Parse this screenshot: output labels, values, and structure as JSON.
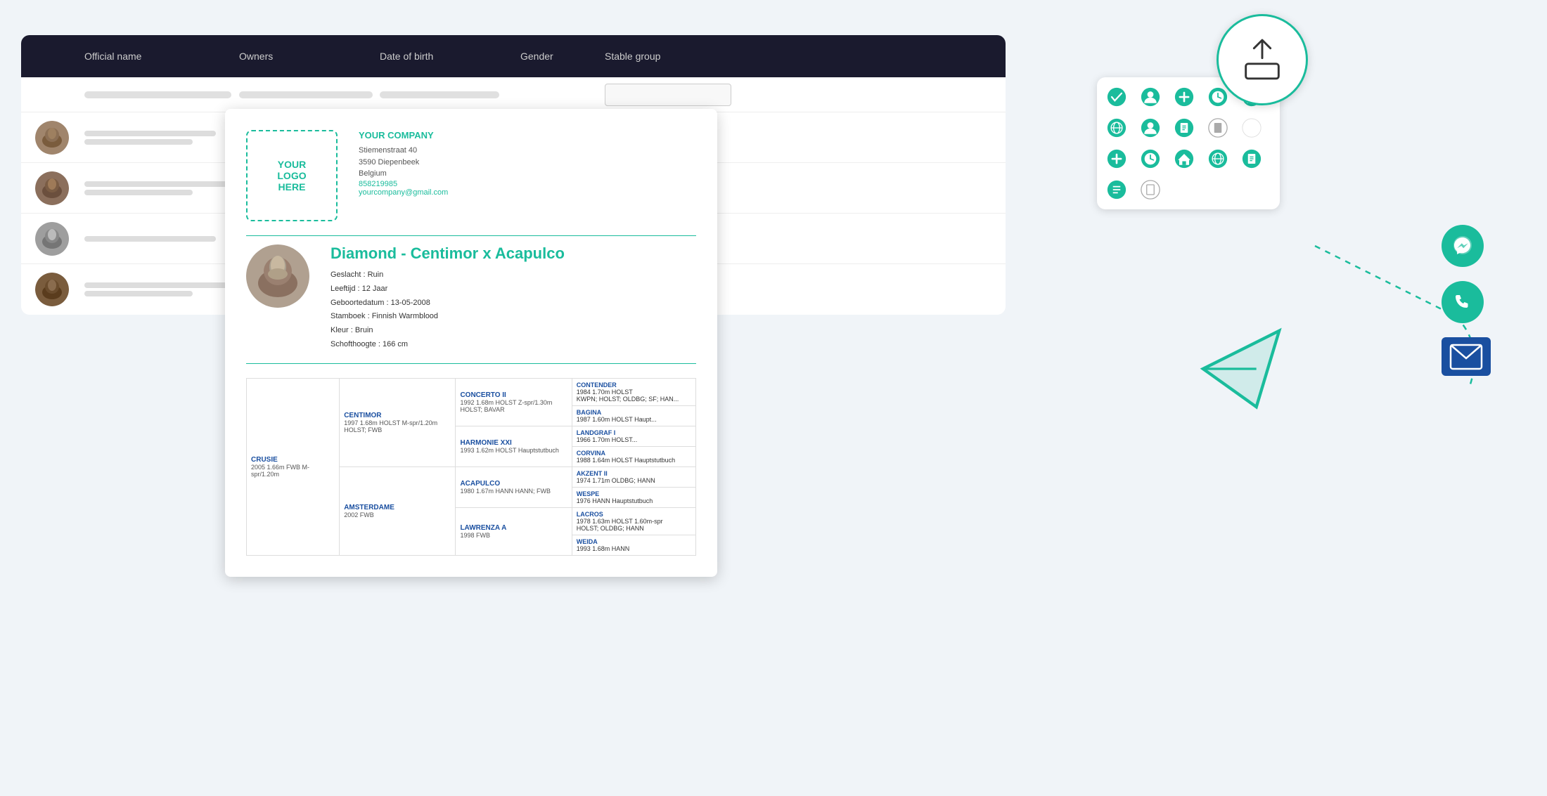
{
  "table": {
    "columns": {
      "official_name": "Official name",
      "owners": "Owners",
      "date_of_birth": "Date of birth",
      "gender": "Gender",
      "stable_group": "Stable group"
    },
    "rows": [
      {
        "avatar": "🐴",
        "avatar_bg": "#a0856c"
      },
      {
        "avatar": "🐴",
        "avatar_bg": "#8b6f5c"
      },
      {
        "avatar": "🐴",
        "avatar_bg": "#9e9e9e"
      },
      {
        "avatar": "🐴",
        "avatar_bg": "#7a5c3d"
      }
    ]
  },
  "document": {
    "logo": {
      "line1": "YOUR",
      "line2": "LOGO",
      "line3": "HERE"
    },
    "company": {
      "name": "YOUR COMPANY",
      "address1": "Stiemenstraat 40",
      "address2": "3590 Diepenbeek",
      "address3": "Belgium",
      "phone": "858219985",
      "email": "yourcompany@gmail.com"
    },
    "horse": {
      "title": "Diamond - Centimor x Acapulco",
      "details": [
        {
          "label": "Geslacht",
          "value": "Ruin"
        },
        {
          "label": "Leeftijd",
          "value": "12 Jaar"
        },
        {
          "label": "Geboortedatum",
          "value": "13-05-2008"
        },
        {
          "label": "Stamboek",
          "value": "Finnish Warmblood"
        },
        {
          "label": "Kleur",
          "value": "Bruin"
        },
        {
          "label": "Schofthoogte",
          "value": "166 cm"
        }
      ]
    },
    "pedigree": {
      "dam_label": "CRUSIE",
      "dam_info": "2005 1.66m FWB M-spr/1.20m",
      "sire1": {
        "name": "CENTIMOR",
        "info": "1997 1.68m HOLST M-spr/1.20m HOLST; FWB"
      },
      "sire1_sire": {
        "name": "CONCERTO II",
        "info": "1992 1.68m HOLST Z-spr/1.30m HOLST; BAVAR"
      },
      "sire1_dam": {
        "name": "HARMONIE XXI",
        "info": "1993 1.62m HOLST Hauptstutbuch"
      },
      "sire2": {
        "name": "AMSTERDAME",
        "info": "2002 FWB"
      },
      "sire2_sire": {
        "name": "ACAPULCO",
        "info": "1980 1.67m HANN HANN; FWB"
      },
      "sire2_dam": {
        "name": "LAWRENZA A",
        "info": "1998 FWB"
      },
      "gg1": {
        "name": "CONTENDER",
        "info": "1984 1.70m HOLST\nKWPN; HOLST; OLDBG; SF; HAN..."
      },
      "gg2": {
        "name": "BAGINA",
        "info": "1987 1.60m HOLST Haupt..."
      },
      "gg3": {
        "name": "LANDGRAF I",
        "info": "1966 1.70m HOLST..."
      },
      "gg4": {
        "name": "CORVINA",
        "info": "1988 1.64m HOLST Hauptstutbuch"
      },
      "gg5": {
        "name": "AKZENT II",
        "info": "1974 1.71m OLDBG; HANN"
      },
      "gg6": {
        "name": "WESPE",
        "info": "1976 HANN Hauptstutbuch"
      },
      "gg7": {
        "name": "LACROS",
        "info": "1978 1.63m HOLST 1.60m-spr\nHOLST; OLDBG; HANN"
      },
      "gg8": {
        "name": "WEIDA",
        "info": "1993 1.68m HANN"
      }
    }
  },
  "actions": {
    "rows": [
      [
        "check",
        "person",
        "plus",
        "clock",
        "barn",
        "globe",
        "user-icon",
        "blank",
        "blank"
      ],
      [
        "plus",
        "time",
        "barn",
        "globe",
        "doc",
        "blank",
        "blank"
      ],
      [
        "plus",
        "time",
        "barn",
        "globe",
        "doc",
        "page",
        "blank"
      ]
    ]
  },
  "share": {
    "icon": "↑",
    "tooltip": "Share / Export"
  },
  "social": {
    "messenger": "💬",
    "phone": "📞",
    "email": "✉"
  }
}
